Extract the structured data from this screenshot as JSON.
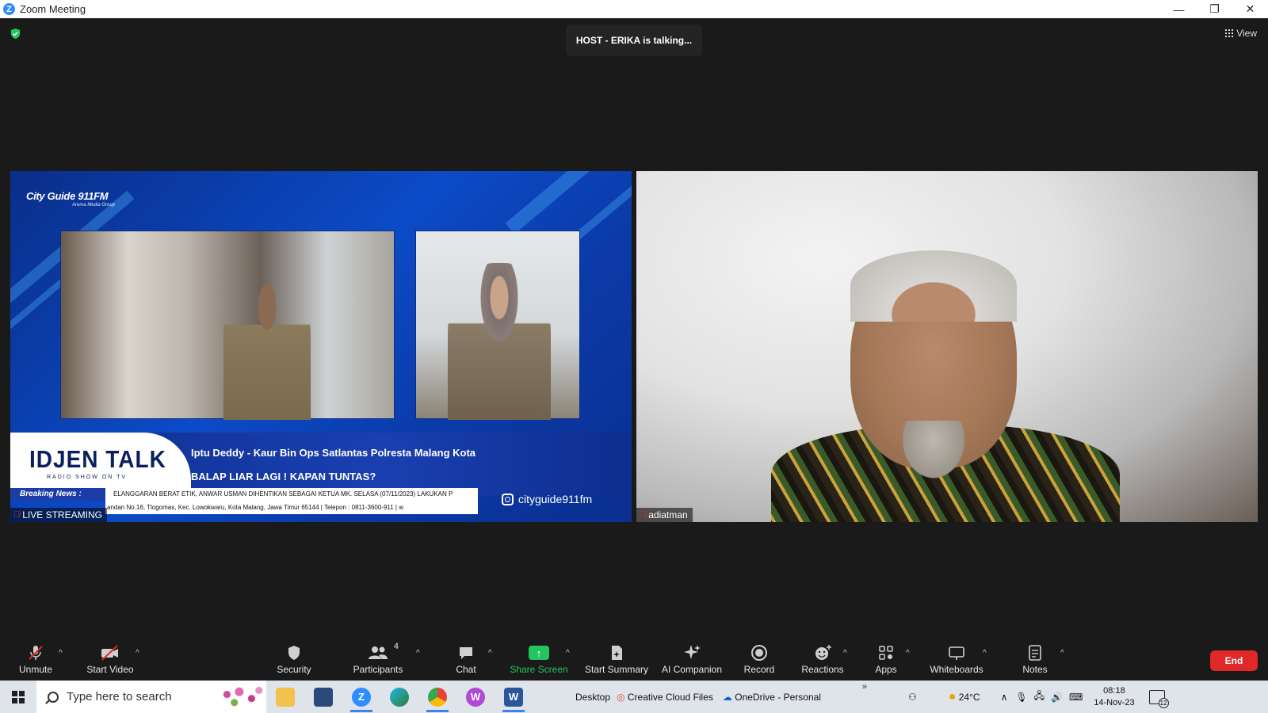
{
  "window": {
    "title": "Zoom Meeting",
    "controls": [
      "—",
      "❐",
      "✕"
    ]
  },
  "meeting": {
    "talking_indicator": "HOST - ERIKA is talking...",
    "view_label": "View",
    "accent_color": "#2d8cff"
  },
  "participants": [
    {
      "name": "LIVE STREAMING",
      "muted": true,
      "stream": {
        "logo": "City Guide 911FM",
        "logo_sub": "Arema Media Group",
        "show_title": "IDJEN TALK",
        "show_subtitle": "RADIO SHOW ON TV",
        "guest_line": "Iptu Deddy - Kaur Bin Ops Satlantas Polresta Malang Kota",
        "topic_line": "BALAP LIAR LAGI ! KAPAN TUNTAS?",
        "breaking_label": "Breaking News :",
        "ticker_1": "ELANGGARAN BERAT ETIK, ANWAR USMAN DIHENTIKAN SEBAGAI KETUA MK. SELASA (07/11/2023) LAKUKAN P",
        "ticker_2": "andan No.16, Tlogomas, Kec. Lowokwaru, Kota Malang, Jawa Timur 65144 | Telepon : 0811-3600-911 | w",
        "instagram": "cityguide911fm"
      }
    },
    {
      "name": "adiatman",
      "muted": true
    }
  ],
  "toolbar": {
    "unmute": "Unmute",
    "start_video": "Start Video",
    "security": "Security",
    "participants": "Participants",
    "participants_count": "4",
    "chat": "Chat",
    "share_screen": "Share Screen",
    "start_summary": "Start Summary",
    "ai_companion": "AI Companion",
    "record": "Record",
    "reactions": "Reactions",
    "apps": "Apps",
    "whiteboards": "Whiteboards",
    "notes": "Notes",
    "end": "End",
    "end_color": "#e02828",
    "share_color": "#22c55e"
  },
  "taskbar": {
    "search_placeholder": "Type here to search",
    "desktop_label": "Desktop",
    "creative_cloud": "Creative Cloud Files",
    "onedrive": "OneDrive - Personal",
    "weather": "24°C",
    "time": "08:18",
    "date": "14-Nov-23",
    "notifications": "12",
    "chevron": "»"
  }
}
